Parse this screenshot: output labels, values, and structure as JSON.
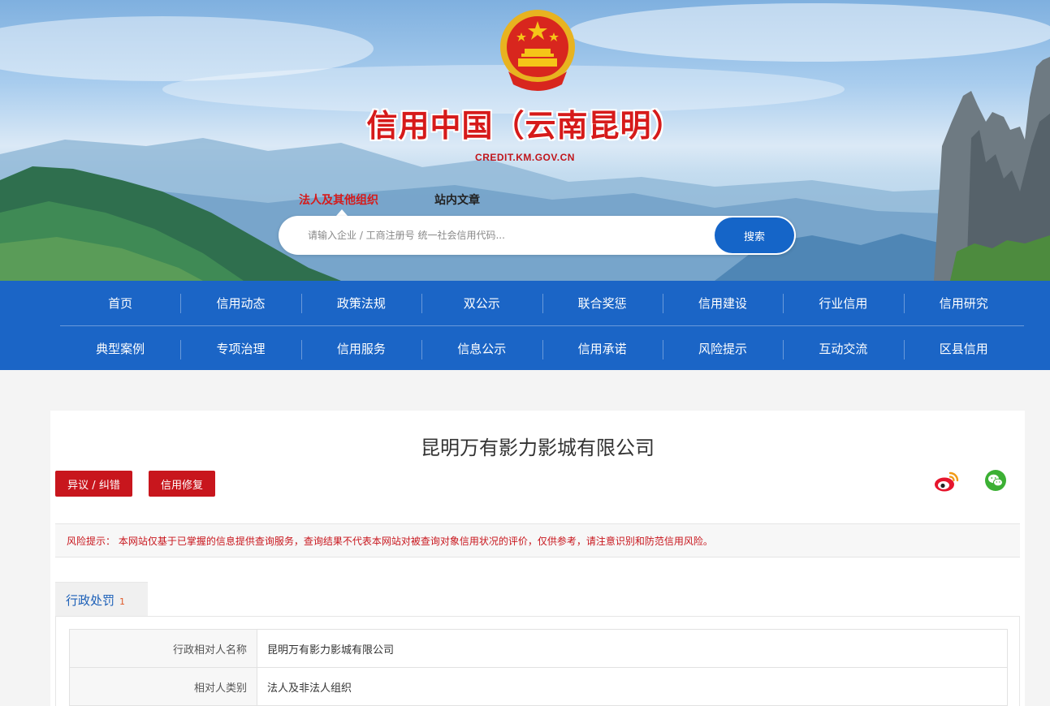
{
  "header": {
    "site_title": "信用中国（云南昆明）",
    "site_domain": "CREDIT.KM.GOV.CN",
    "emblem_icon": "national-emblem-icon"
  },
  "search": {
    "tabs": [
      {
        "label": "法人及其他组织",
        "active": true
      },
      {
        "label": "站内文章",
        "active": false
      }
    ],
    "placeholder": "请输入企业 / 工商注册号 统一社会信用代码...",
    "value": "",
    "button_label": "搜索"
  },
  "nav": {
    "row1": [
      "首页",
      "信用动态",
      "政策法规",
      "双公示",
      "联合奖惩",
      "信用建设",
      "行业信用",
      "信用研究"
    ],
    "row2": [
      "典型案例",
      "专项治理",
      "信用服务",
      "信息公示",
      "信用承诺",
      "风险提示",
      "互动交流",
      "区县信用"
    ]
  },
  "company": {
    "name": "昆明万有影力影城有限公司",
    "actions": {
      "dispute": "异议 / 纠错",
      "repair": "信用修复"
    },
    "share": [
      "weibo-icon",
      "wechat-icon"
    ],
    "risk_notice": "风险提示： 本网站仅基于已掌握的信息提供查询服务，查询结果不代表本网站对被查询对象信用状况的评价，仅供参考，请注意识别和防范信用风险。"
  },
  "tabs": [
    {
      "label": "行政处罚",
      "count": "1"
    }
  ],
  "details": [
    {
      "label": "行政相对人名称",
      "value": "昆明万有影力影城有限公司"
    },
    {
      "label": "相对人类别",
      "value": "法人及非法人组织"
    }
  ],
  "colors": {
    "nav_blue": "#1b65c6",
    "brand_red": "#c8161d",
    "search_blue": "#1565c8"
  }
}
